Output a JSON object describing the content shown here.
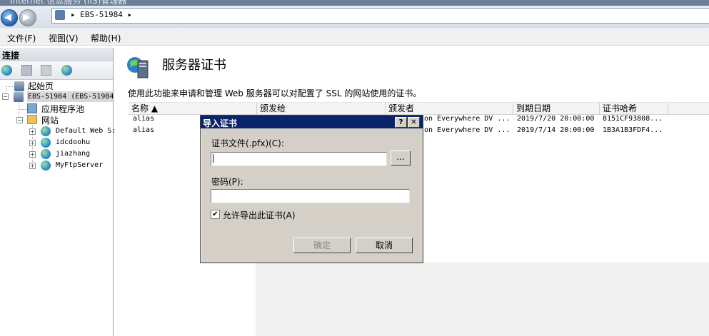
{
  "window": {
    "title": "Internet 信息服务 (IIS)管理器"
  },
  "address": {
    "path": "EBS-51984",
    "separator": "▸"
  },
  "menu": [
    "文件(F)",
    "视图(V)",
    "帮助(H)"
  ],
  "connections": {
    "header": "连接",
    "tree": {
      "start_page": "起始页",
      "server": "EBS-51984 (EBS-51984",
      "app_pools": "应用程序池",
      "sites": "网站",
      "site_items": [
        "Default Web S:",
        "idcdoohu",
        "jiazhang",
        "MyFtpServer"
      ]
    }
  },
  "main": {
    "title": "服务器证书",
    "description": "使用此功能来申请和管理 Web 服务器可以对配置了 SSL 的网站使用的证书。",
    "columns": [
      "名称 ▲",
      "颁发给",
      "颁发者",
      "到期日期",
      "证书哈希"
    ],
    "rows": [
      {
        "name": "alias",
        "issuer": "on Everywhere DV ...",
        "expires": "2019/7/20 20:00:00",
        "hash": "8151CF93808..."
      },
      {
        "name": "alias",
        "issuer": "on Everywhere DV ...",
        "expires": "2019/7/14 20:00:00",
        "hash": "1B3A1B3FDF4..."
      }
    ]
  },
  "dialog": {
    "title": "导入证书",
    "help_label": "?",
    "close_label": "✕",
    "file_label": "证书文件(.pfx)(C):",
    "file_value": "",
    "browse_label": "...",
    "password_label": "密码(P):",
    "password_value": "",
    "allow_export_label": "允许导出此证书(A)",
    "allow_export_checked": "✔",
    "ok_label": "确定",
    "cancel_label": "取消"
  }
}
